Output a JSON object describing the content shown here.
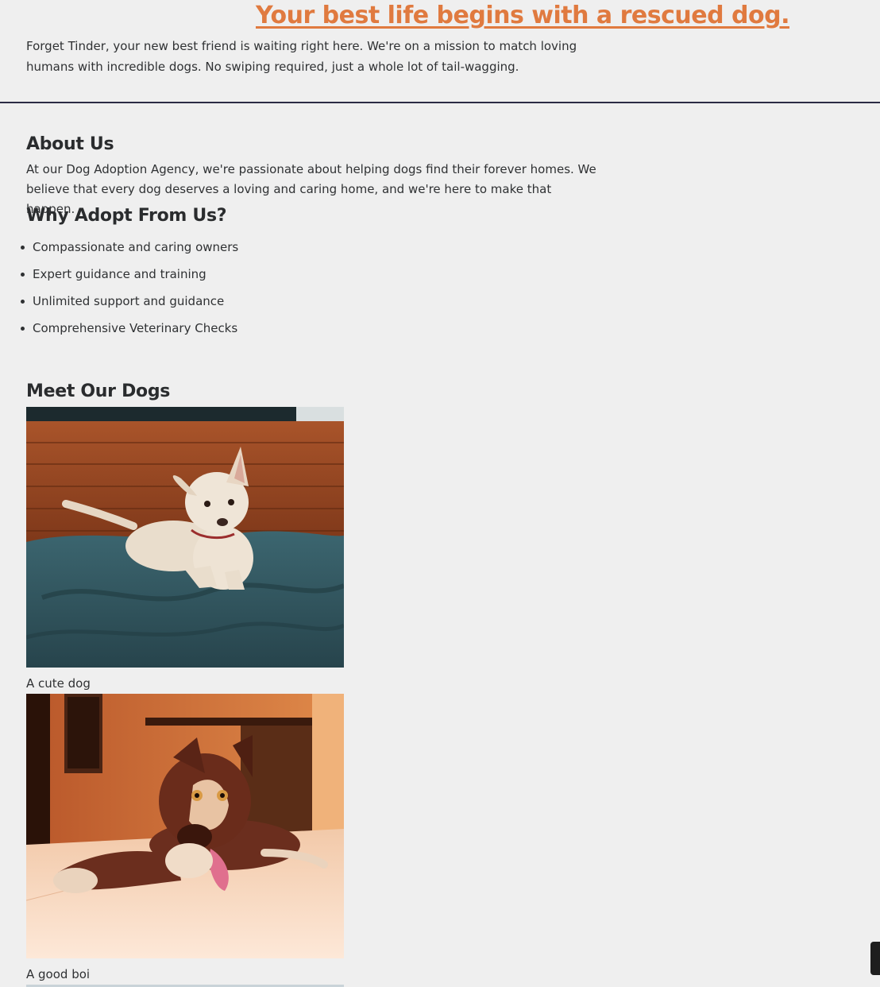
{
  "hero": {
    "title": "Your best life begins with a rescued dog.",
    "text": "Forget Tinder, your new best friend is waiting right here. We're on a mission to match loving humans with incredible dogs. No swiping required, just a whole lot of tail-wagging."
  },
  "about": {
    "heading": "About Us",
    "text": "At our Dog Adoption Agency, we're passionate about helping dogs find their forever homes. We believe that every dog deserves a loving and caring home, and we're here to make that happen."
  },
  "why": {
    "heading": "Why Adopt From Us?",
    "items": [
      "Compassionate and caring owners",
      "Expert guidance and training",
      "Unlimited support and guidance",
      "Comprehensive Veterinary Checks"
    ]
  },
  "dogs": {
    "heading": "Meet Our Dogs",
    "items": [
      {
        "caption": "A cute dog"
      },
      {
        "caption": "A good boi"
      }
    ]
  },
  "colors": {
    "accent": "#e07a3f",
    "background": "#efefef",
    "text": "#2f3133",
    "divider": "#2b2b45"
  }
}
